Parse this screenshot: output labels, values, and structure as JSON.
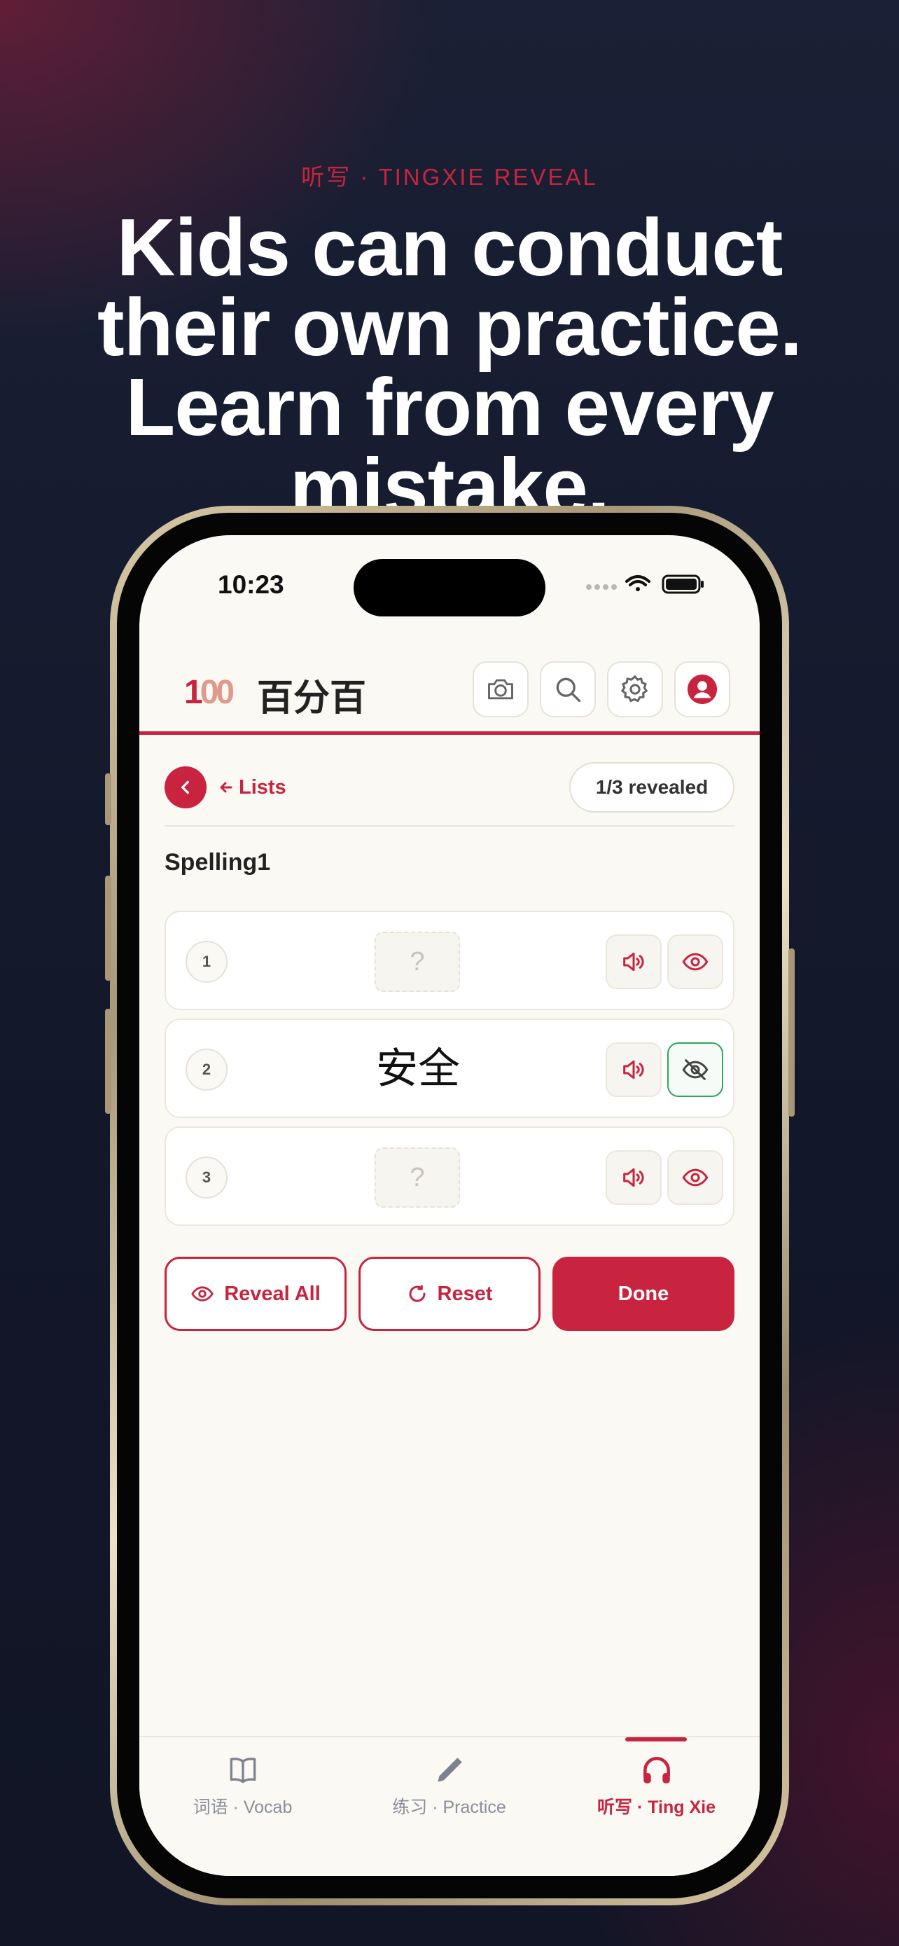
{
  "hero": {
    "kicker": "听写 · TINGXIE REVEAL",
    "headline_lines": [
      "Kids can conduct",
      "their own practice.",
      "Learn from every",
      "mistake."
    ]
  },
  "status_bar": {
    "time": "10:23"
  },
  "app": {
    "logo_text_a": "1",
    "logo_text_b": "00",
    "title": "百分百",
    "header_icons": [
      "camera-icon",
      "search-icon",
      "gear-icon",
      "profile-icon"
    ]
  },
  "nav": {
    "back_link": "Lists",
    "revealed_status": "1/3 revealed"
  },
  "list": {
    "name": "Spelling1",
    "items": [
      {
        "number": "1",
        "word": "?",
        "revealed": false
      },
      {
        "number": "2",
        "word": "安全",
        "revealed": true
      },
      {
        "number": "3",
        "word": "?",
        "revealed": false
      }
    ]
  },
  "actions": {
    "reveal_all": "Reveal All",
    "reset": "Reset",
    "done": "Done"
  },
  "tabs": [
    {
      "label": "词语 · Vocab",
      "icon": "book-icon",
      "active": false
    },
    {
      "label": "练习 · Practice",
      "icon": "pencil-icon",
      "active": false
    },
    {
      "label": "听写 · Ting Xie",
      "icon": "headphones-icon",
      "active": true
    }
  ],
  "colors": {
    "accent": "#c8243f",
    "active_eye": "#2fa65a",
    "screen_bg": "#fbf9f4"
  }
}
